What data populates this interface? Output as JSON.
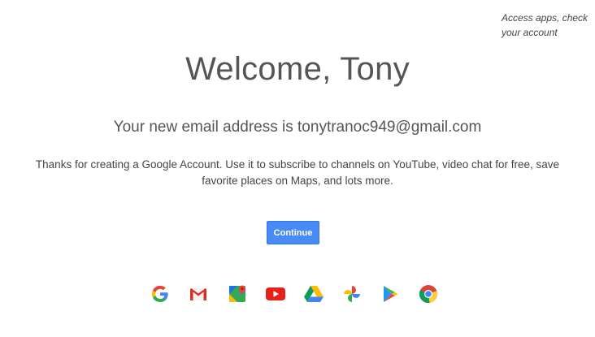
{
  "hint": {
    "text": "Access apps, check your account"
  },
  "welcome": {
    "title": "Welcome, Tony",
    "email_line": "Your new email address is tonytranoc949@gmail.com",
    "body": "Thanks for creating a Google Account. Use it to subscribe to channels on YouTube, video chat for free, save favorite places on Maps, and lots more."
  },
  "continue_button": {
    "label": "Continue",
    "color": "#4a8af4"
  },
  "apps": [
    {
      "name": "google-icon"
    },
    {
      "name": "gmail-icon"
    },
    {
      "name": "maps-icon"
    },
    {
      "name": "youtube-icon"
    },
    {
      "name": "drive-icon"
    },
    {
      "name": "photos-icon"
    },
    {
      "name": "play-store-icon"
    },
    {
      "name": "chrome-icon"
    }
  ]
}
